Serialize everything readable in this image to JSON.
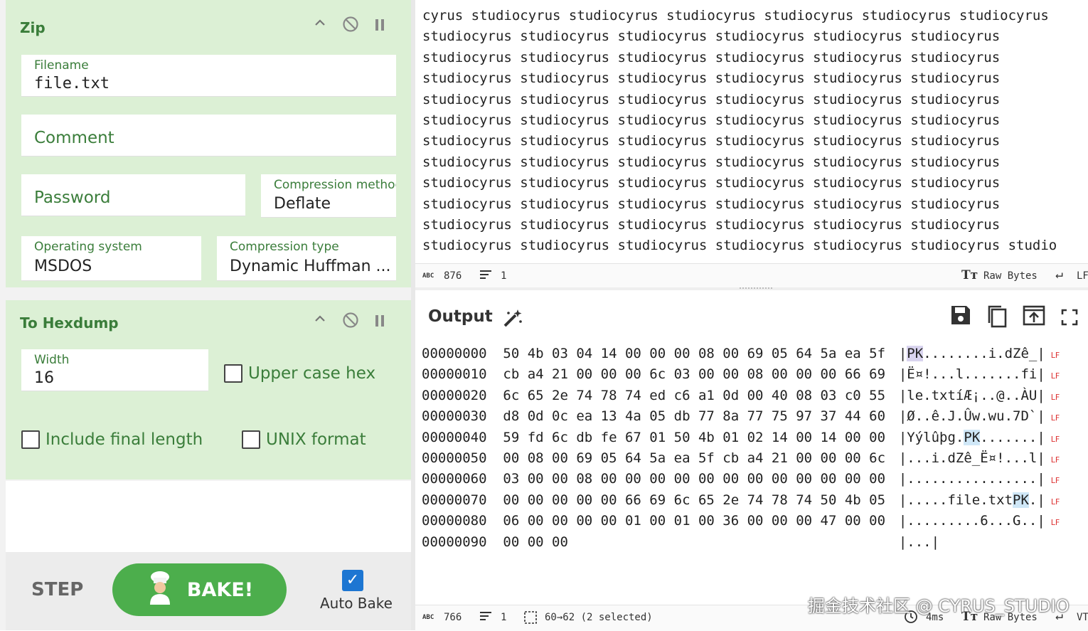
{
  "zip": {
    "title": "Zip",
    "filename_label": "Filename",
    "filename_value": "file.txt",
    "comment_placeholder": "Comment",
    "password_placeholder": "Password",
    "compression_method_label": "Compression method",
    "compression_method_value": "Deflate",
    "os_label": "Operating system",
    "os_value": "MSDOS",
    "compression_type_label": "Compression type",
    "compression_type_value": "Dynamic Huffman ..."
  },
  "hexdump": {
    "title": "To Hexdump",
    "width_label": "Width",
    "width_value": "16",
    "upper_case_label": "Upper case hex",
    "include_final_label": "Include final length",
    "unix_format_label": "UNIX format"
  },
  "controls": {
    "step_label": "STEP",
    "bake_label": "BAKE!",
    "auto_bake_label": "Auto Bake",
    "auto_bake_checked": true
  },
  "input": {
    "lines": [
      "cyrus studiocyrus studiocyrus studiocyrus studiocyrus studiocyrus studiocyrus",
      "studiocyrus studiocyrus studiocyrus studiocyrus studiocyrus studiocyrus",
      "studiocyrus studiocyrus studiocyrus studiocyrus studiocyrus studiocyrus",
      "studiocyrus studiocyrus studiocyrus studiocyrus studiocyrus studiocyrus",
      "studiocyrus studiocyrus studiocyrus studiocyrus studiocyrus studiocyrus",
      "studiocyrus studiocyrus studiocyrus studiocyrus studiocyrus studiocyrus",
      "studiocyrus studiocyrus studiocyrus studiocyrus studiocyrus studiocyrus",
      "studiocyrus studiocyrus studiocyrus studiocyrus studiocyrus studiocyrus",
      "studiocyrus studiocyrus studiocyrus studiocyrus studiocyrus studiocyrus",
      "studiocyrus studiocyrus studiocyrus studiocyrus studiocyrus studiocyrus",
      "studiocyrus studiocyrus studiocyrus studiocyrus studiocyrus studiocyrus",
      "studiocyrus studiocyrus studiocyrus studiocyrus studiocyrus studiocyrus studio"
    ],
    "status": {
      "length": "876",
      "lines": "1",
      "encoding": "Raw Bytes",
      "eol": "LF"
    }
  },
  "output": {
    "title": "Output",
    "rows": [
      {
        "offset": "00000000",
        "hex": "50 4b 03 04 14 00 00 00 08 00 69 05 64 5a ea 5f",
        "ascii_pre": "",
        "ascii_hl": "PK",
        "ascii_post": "........i.dZê_",
        "hl_class": "hl2"
      },
      {
        "offset": "00000010",
        "hex": "cb a4 21 00 00 00 6c 03 00 00 08 00 00 00 66 69",
        "ascii_pre": "Ë¤!...l.......fi",
        "ascii_hl": "",
        "ascii_post": ""
      },
      {
        "offset": "00000020",
        "hex": "6c 65 2e 74 78 74 ed c6 a1 0d 00 40 08 03 c0 55",
        "ascii_pre": "le.txtíÆ¡..@..ÀU",
        "ascii_hl": "",
        "ascii_post": ""
      },
      {
        "offset": "00000030",
        "hex": "d8 0d 0c ea 13 4a 05 db 77 8a 77 75 97 37 44 60",
        "ascii_pre": "Ø..ê.J.Ûw.wu.7D`",
        "ascii_hl": "",
        "ascii_post": ""
      },
      {
        "offset": "00000040",
        "hex": "59 fd 6c db fe 67 01 50 4b 01 02 14 00 14 00 00",
        "ascii_pre": "Yýlûþg.",
        "ascii_hl": "PK",
        "ascii_post": "......."
      },
      {
        "offset": "00000050",
        "hex": "00 08 00 69 05 64 5a ea 5f cb a4 21 00 00 00 6c",
        "ascii_pre": "...i.dZê_Ë¤!...l",
        "ascii_hl": "",
        "ascii_post": ""
      },
      {
        "offset": "00000060",
        "hex": "03 00 00 08 00 00 00 00 00 00 00 00 00 00 00 00",
        "ascii_pre": "................",
        "ascii_hl": "",
        "ascii_post": ""
      },
      {
        "offset": "00000070",
        "hex": "00 00 00 00 00 66 69 6c 65 2e 74 78 74 50 4b 05",
        "ascii_pre": ".....file.txt",
        "ascii_hl": "PK",
        "ascii_post": "."
      },
      {
        "offset": "00000080",
        "hex": "06 00 00 00 00 01 00 01 00 36 00 00 00 47 00 00",
        "ascii_pre": ".........6...G..",
        "ascii_hl": "",
        "ascii_post": ""
      },
      {
        "offset": "00000090",
        "hex": "00 00 00",
        "ascii_pre": "...",
        "ascii_hl": "",
        "ascii_post": "",
        "last": true
      }
    ],
    "lf_marker": "LF",
    "status": {
      "length": "766",
      "lines": "1",
      "selection": "60→62 (2 selected)",
      "time": "4ms",
      "encoding": "Raw Bytes",
      "eol": "VT"
    }
  },
  "watermark": "掘金技术社区 @ CYRUS_STUDIO"
}
